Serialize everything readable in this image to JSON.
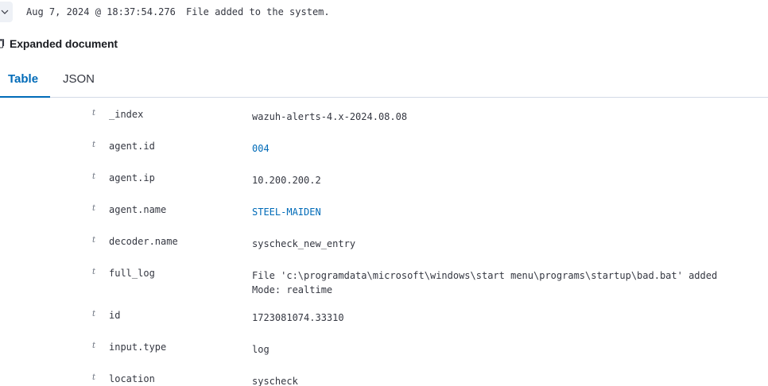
{
  "summary": {
    "timestamp": "Aug 7, 2024 @ 18:37:54.276",
    "message": "File added to the system."
  },
  "document": {
    "title": "Expanded document"
  },
  "tabs": [
    {
      "label": "Table"
    },
    {
      "label": "JSON"
    }
  ],
  "fields": [
    {
      "type": "t",
      "name": "_index",
      "value": "wazuh-alerts-4.x-2024.08.08",
      "link": false
    },
    {
      "type": "t",
      "name": "agent.id",
      "value": "004",
      "link": true
    },
    {
      "type": "t",
      "name": "agent.ip",
      "value": "10.200.200.2",
      "link": false
    },
    {
      "type": "t",
      "name": "agent.name",
      "value": "STEEL-MAIDEN",
      "link": true
    },
    {
      "type": "t",
      "name": "decoder.name",
      "value": "syscheck_new_entry",
      "link": false
    },
    {
      "type": "t",
      "name": "full_log",
      "value": "File 'c:\\programdata\\microsoft\\windows\\start menu\\programs\\startup\\bad.bat' added\nMode: realtime",
      "link": false
    },
    {
      "type": "t",
      "name": "id",
      "value": "1723081074.33310",
      "link": false
    },
    {
      "type": "t",
      "name": "input.type",
      "value": "log",
      "link": false
    },
    {
      "type": "t",
      "name": "location",
      "value": "syscheck",
      "link": false
    }
  ],
  "colors": {
    "accent": "#006bb8",
    "text": "#343741",
    "border": "#d3dae6"
  },
  "icons": {
    "expand_toggle": "chevron-down-icon",
    "document": "document-icon",
    "field_type": "string-type-icon"
  }
}
